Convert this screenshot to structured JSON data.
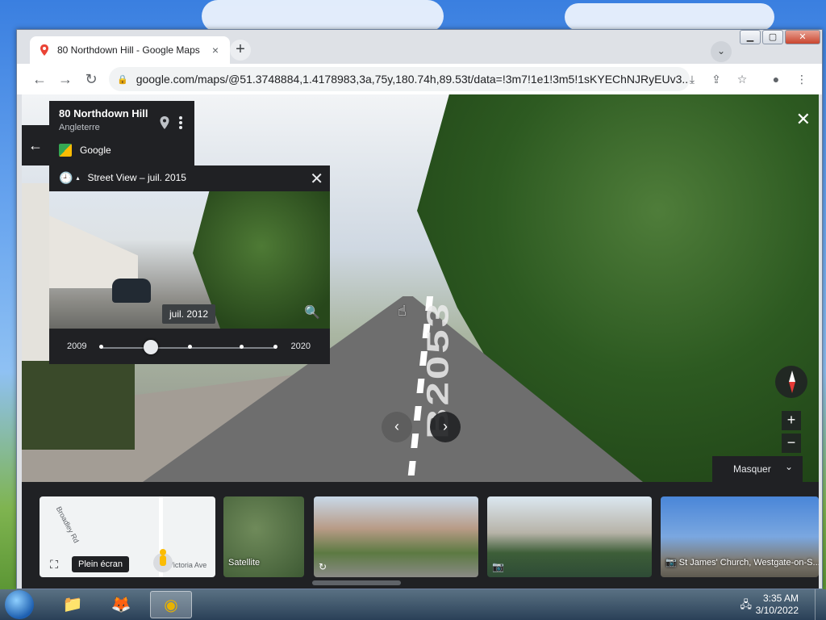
{
  "browser": {
    "tab_title": "80 Northdown Hill - Google Maps",
    "tab_close": "×",
    "new_tab": "+",
    "tab_search": "⌄",
    "window_buttons": {
      "minimize": "▁",
      "maximize": "▢",
      "close": "✕"
    },
    "url": "google.com/maps/@51.3748884,1.4178983,3a,75y,180.74h,89.53t/data=!3m7!1e1!3m5!1sKYEChNJRyEUv3..."
  },
  "toolbar": {
    "back": "←",
    "forward": "→",
    "reload": "↻",
    "lock": "🔒",
    "download": "⤓",
    "share": "⇪",
    "bookmark": "☆",
    "profile": "●",
    "menu": "⋮"
  },
  "place": {
    "name": "80 Northdown Hill",
    "region": "Angleterre",
    "provider": "Google",
    "back_label": "←"
  },
  "timemachine": {
    "header": "Street View – juil. 2015",
    "clock_icon": "🕘",
    "caret": "▴",
    "close": "✕",
    "selected_date": "juil. 2012",
    "zoom_icon": "🔍",
    "year_start": "2009",
    "year_end": "2020",
    "selected_fraction": 0.2857
  },
  "scene": {
    "road_marking": "B2053",
    "close": "✕",
    "prev": "‹",
    "next": "›",
    "zoom_in": "+",
    "zoom_out": "−"
  },
  "masquer": {
    "label": "Masquer",
    "chev": "⌄"
  },
  "strip": {
    "fullscreen_icon": "⛶",
    "fullscreen_tip": "Plein écran",
    "street_a": "Broadley Rd",
    "street_b": "Victoria Ave",
    "satellite": "Satellite",
    "photo_icon": "📷",
    "pano_icon": "↻",
    "church": "St James' Church, Westgate-on-S..."
  },
  "taskbar": {
    "time": "3:35 AM",
    "date": "3/10/2022",
    "tray_icon": "🖧",
    "folder_icon": "📁",
    "firefox_icon": "🦊",
    "chrome_icon": "◉"
  },
  "colors": {
    "accent_red": "#e53935",
    "panel_bg": "#202124",
    "chrome_bg": "#dee1e6"
  }
}
